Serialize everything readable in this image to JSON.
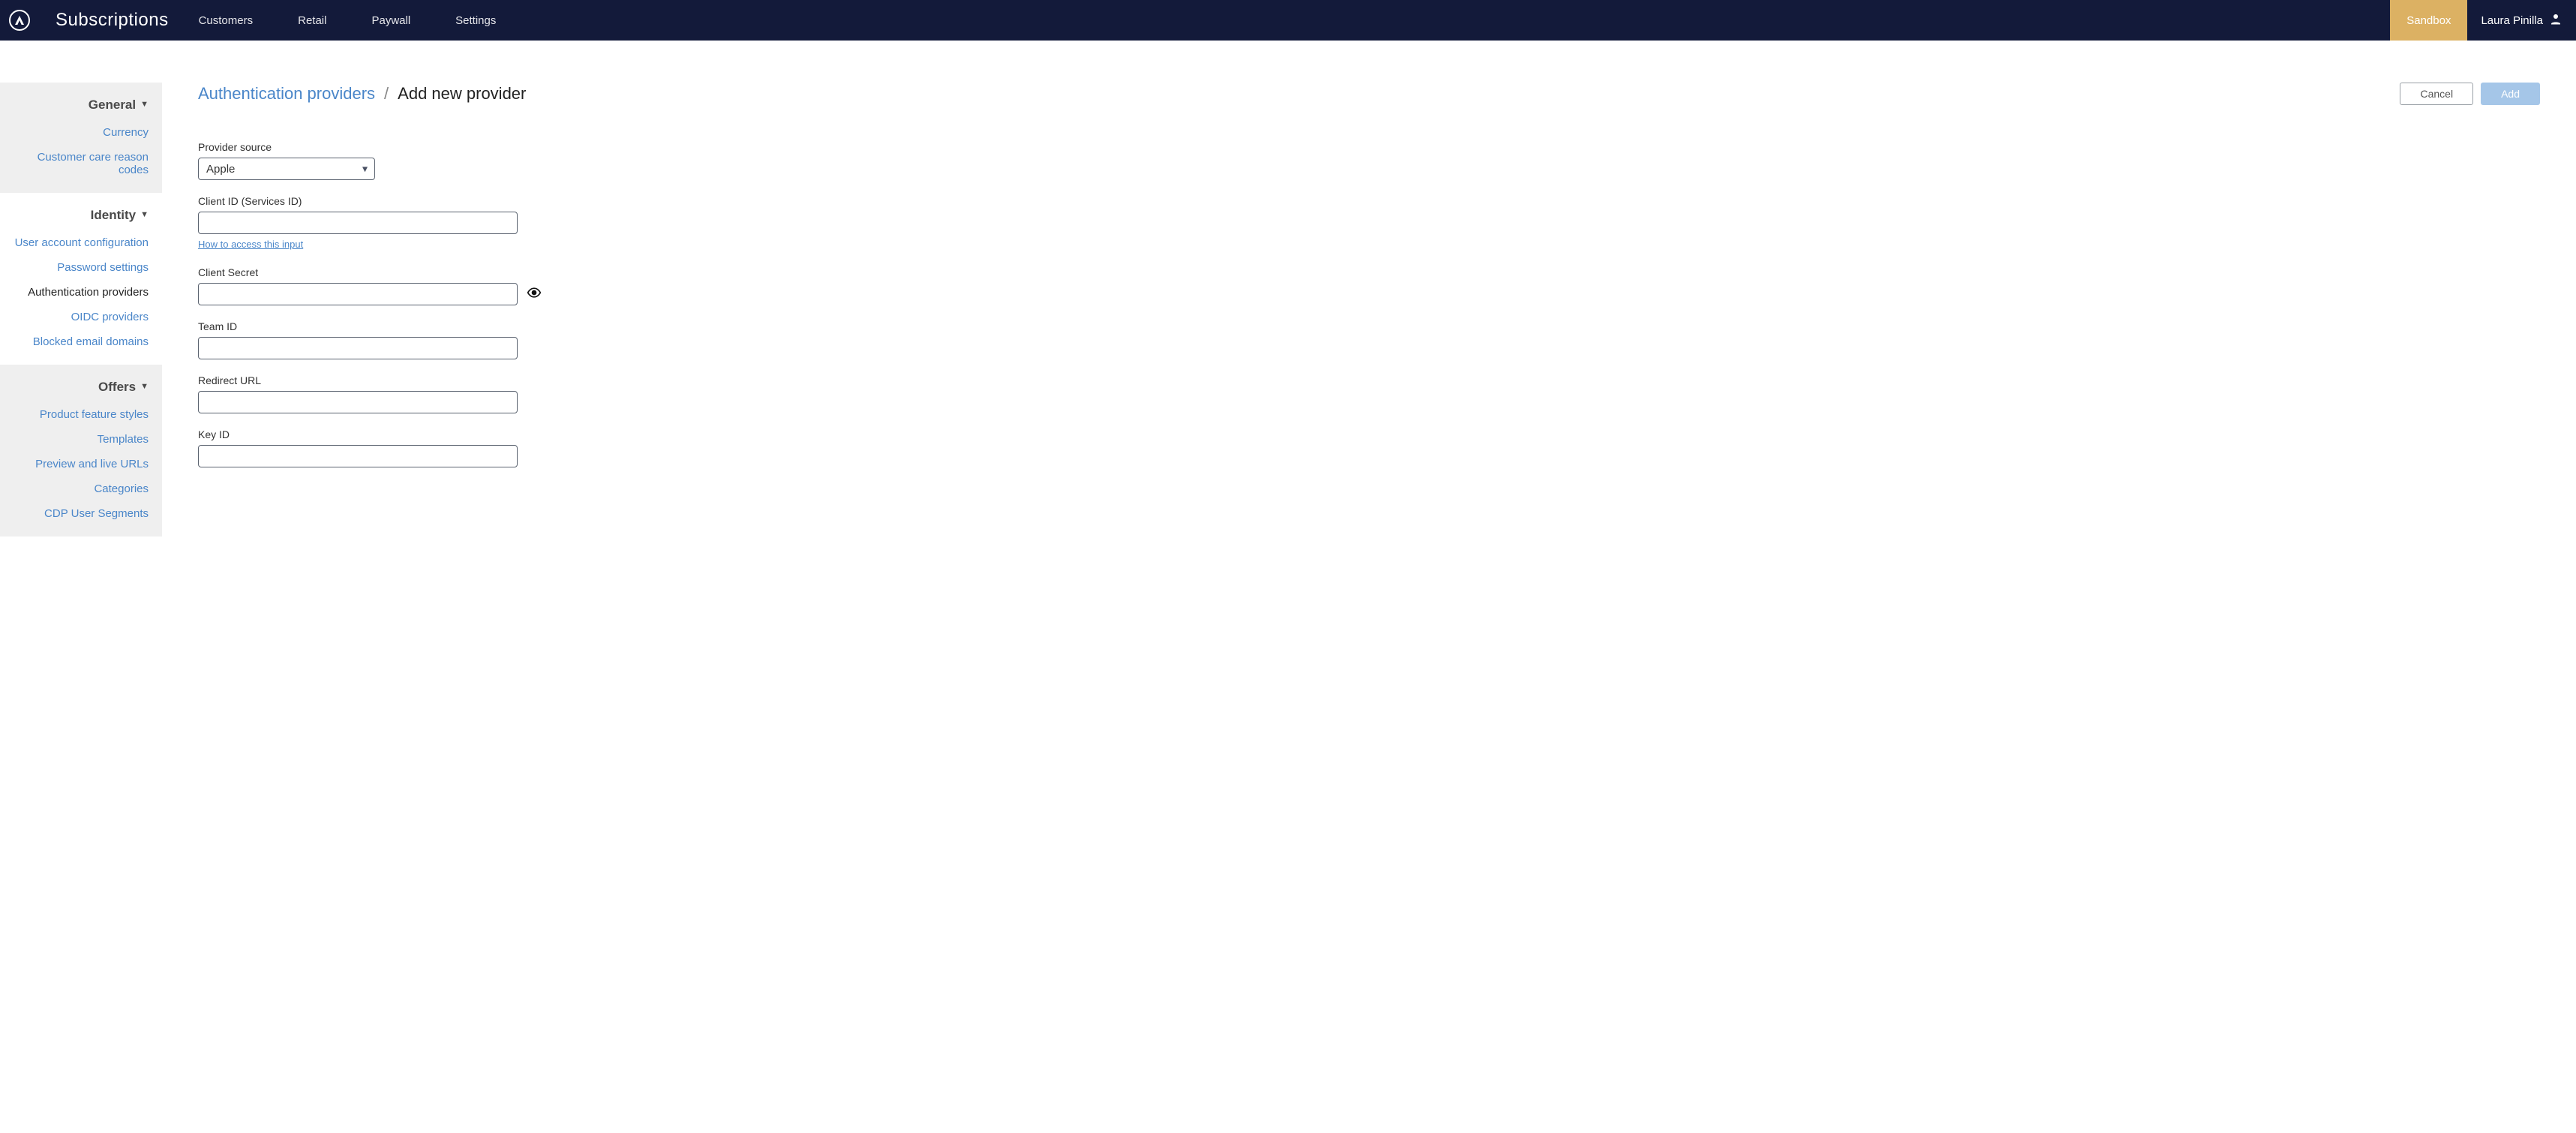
{
  "app": {
    "title": "Subscriptions"
  },
  "nav": {
    "links": [
      {
        "label": "Customers"
      },
      {
        "label": "Retail"
      },
      {
        "label": "Paywall"
      },
      {
        "label": "Settings"
      }
    ],
    "env": "Sandbox",
    "user": "Laura Pinilla"
  },
  "sidebar": {
    "groups": [
      {
        "title": "General",
        "shaded": true,
        "items": [
          {
            "label": "Currency",
            "active": false
          },
          {
            "label": "Customer care reason codes",
            "active": false
          }
        ]
      },
      {
        "title": "Identity",
        "shaded": false,
        "items": [
          {
            "label": "User account configuration",
            "active": false
          },
          {
            "label": "Password settings",
            "active": false
          },
          {
            "label": "Authentication providers",
            "active": true
          },
          {
            "label": "OIDC providers",
            "active": false
          },
          {
            "label": "Blocked email domains",
            "active": false
          }
        ]
      },
      {
        "title": "Offers",
        "shaded": true,
        "items": [
          {
            "label": "Product feature styles",
            "active": false
          },
          {
            "label": "Templates",
            "active": false
          },
          {
            "label": "Preview and live URLs",
            "active": false
          },
          {
            "label": "Categories",
            "active": false
          },
          {
            "label": "CDP User Segments",
            "active": false
          }
        ]
      }
    ]
  },
  "breadcrumb": {
    "parent": "Authentication providers",
    "sep": "/",
    "current": "Add new provider"
  },
  "actions": {
    "cancel": "Cancel",
    "add": "Add"
  },
  "form": {
    "provider_source": {
      "label": "Provider source",
      "value": "Apple"
    },
    "client_id": {
      "label": "Client ID (Services ID)",
      "value": "",
      "help": "How to access this input"
    },
    "client_secret": {
      "label": "Client Secret",
      "value": ""
    },
    "team_id": {
      "label": "Team ID",
      "value": ""
    },
    "redirect_url": {
      "label": "Redirect URL",
      "value": ""
    },
    "key_id": {
      "label": "Key ID",
      "value": ""
    }
  }
}
